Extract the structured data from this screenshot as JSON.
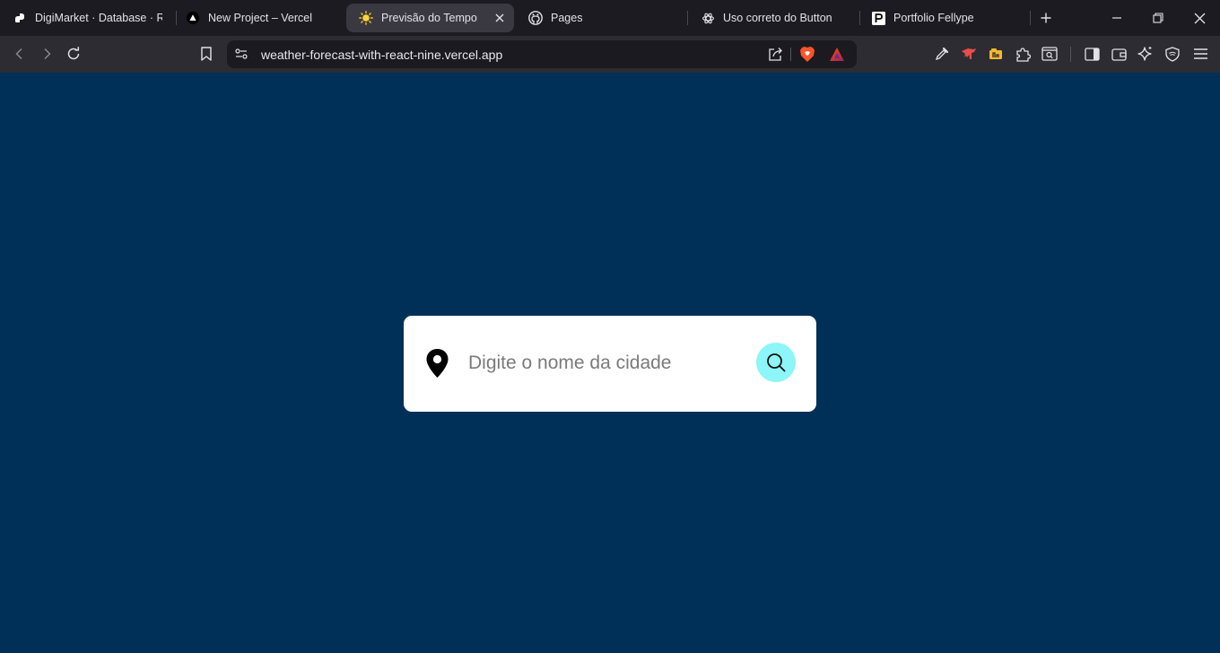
{
  "browser": {
    "tabs": [
      {
        "title": "DigiMarket · Database · Re",
        "icon": "supabase-icon"
      },
      {
        "title": "New Project – Vercel",
        "icon": "vercel-icon"
      },
      {
        "title": "Previsão do Tempo",
        "icon": "sun-icon",
        "active": true
      },
      {
        "title": "Pages",
        "icon": "github-icon"
      },
      {
        "title": "Uso correto do Button",
        "icon": "openai-icon"
      },
      {
        "title": "Portfolio Fellype",
        "icon": "p-letter-icon"
      }
    ],
    "url": "weather-forecast-with-react-nine.vercel.app"
  },
  "page": {
    "background_color": "#003058",
    "search": {
      "placeholder": "Digite o nome da cidade",
      "value": "",
      "button_color": "#8cf6f9"
    }
  }
}
